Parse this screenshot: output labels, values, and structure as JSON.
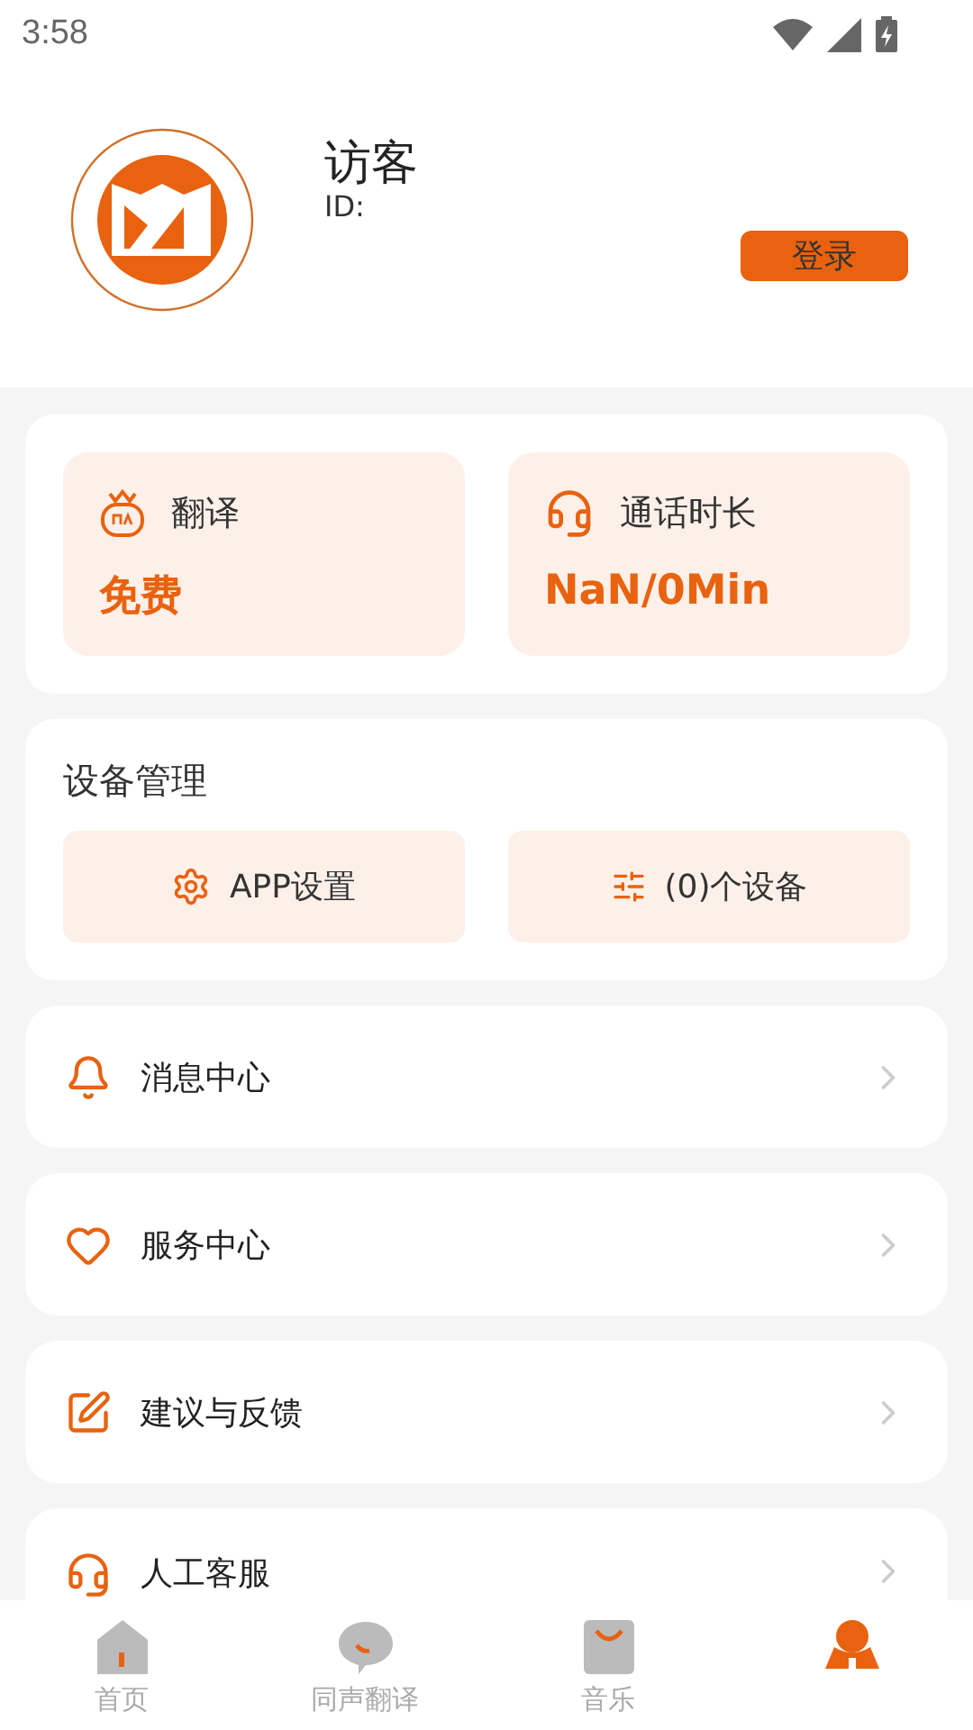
{
  "status_bar": {
    "time": "3:58"
  },
  "profile": {
    "name": "访客",
    "id_label": "ID:",
    "login_button": "登录"
  },
  "stats": [
    {
      "kind": "translate",
      "label": "翻译",
      "value": "免费"
    },
    {
      "kind": "call",
      "label": "通话时长",
      "value": "NaN/0Min"
    }
  ],
  "device_section": {
    "title": "设备管理",
    "buttons": [
      {
        "kind": "settings",
        "label": "APP设置"
      },
      {
        "kind": "devices",
        "label": "(0)个设备"
      }
    ]
  },
  "menu": [
    {
      "kind": "bell",
      "label": "消息中心"
    },
    {
      "kind": "heart",
      "label": "服务中心"
    },
    {
      "kind": "edit",
      "label": "建议与反馈"
    },
    {
      "kind": "headset",
      "label": "人工客服"
    }
  ],
  "tabs": [
    {
      "kind": "home",
      "label": "首页",
      "selected": false
    },
    {
      "kind": "chat",
      "label": "同声翻译",
      "selected": false
    },
    {
      "kind": "bag",
      "label": "音乐",
      "selected": false
    },
    {
      "kind": "me",
      "selected": true
    }
  ]
}
